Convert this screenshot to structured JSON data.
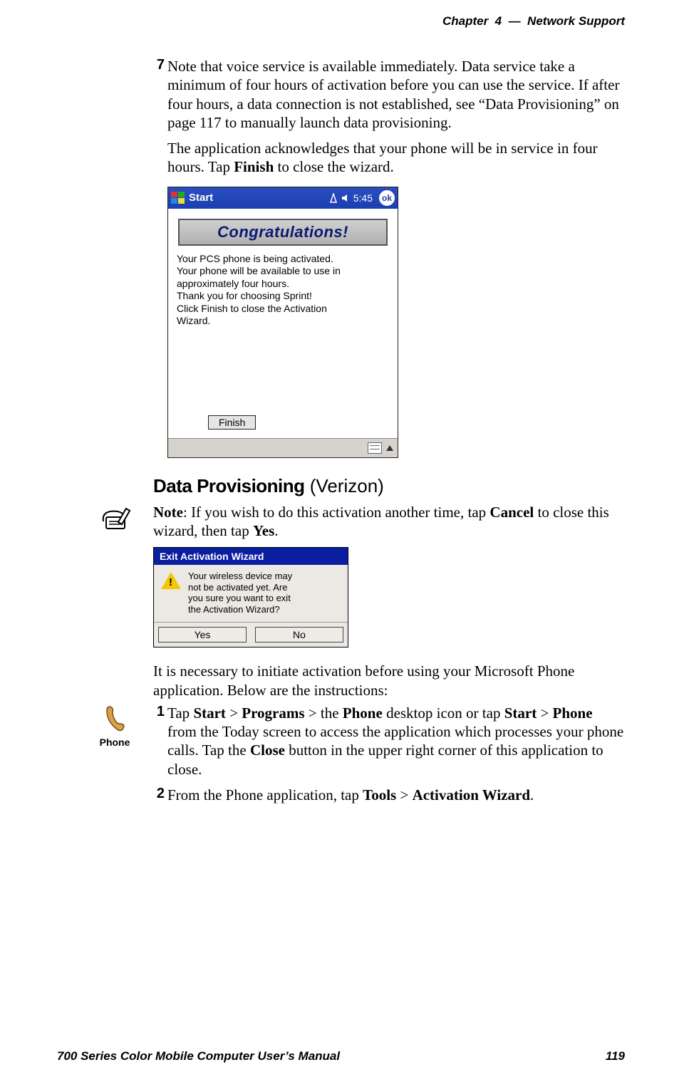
{
  "header": {
    "chapter_label": "Chapter",
    "chapter_number": "4",
    "separator": "—",
    "chapter_title": "Network Support"
  },
  "step7": {
    "number": "7",
    "para1": "Note that voice service is available immediately. Data service take a minimum of four hours of activation before you can use the service. If after four hours, a data connection is not established, see “Data Provisioning” on page 117 to manually launch data provisioning.",
    "para2_a": "The application acknowledges that your phone will be in service in four hours. Tap ",
    "para2_b": "Finish",
    "para2_c": " to close the wizard."
  },
  "ppc": {
    "start_label": "Start",
    "clock": "5:45",
    "ok": "ok",
    "banner": "Congratulations!",
    "msg": [
      "Your PCS phone is being activated.",
      "Your phone will be available to use in",
      "approximately four hours.",
      "Thank you for choosing Sprint!",
      "Click Finish to close the Activation",
      "Wizard."
    ],
    "finish_btn": "Finish"
  },
  "section": {
    "title_bold": "Data Provisioning",
    "title_light": " (Verizon)"
  },
  "note": {
    "label": "Note",
    "text_a": ": If you wish to do this activation another time, tap ",
    "bold1": "Cancel",
    "text_b": " to close this wizard, then tap ",
    "bold2": "Yes",
    "text_c": "."
  },
  "exit_dialog": {
    "title": "Exit Activation Wizard",
    "msg": [
      "Your wireless device may",
      "not be activated yet.  Are",
      "you sure you want to exit",
      "the Activation Wizard?"
    ],
    "yes": "Yes",
    "no": "No"
  },
  "intro_para": "It is necessary to initiate activation before using your Microsoft Phone application. Below are the instructions:",
  "phone_icon_label": "Phone",
  "step1": {
    "number": "1",
    "t1": "Tap ",
    "b1": "Start",
    "t2": " > ",
    "b2": "Programs",
    "t3": " > the ",
    "b3": "Phone",
    "t4": " desktop icon or tap ",
    "b4": "Start",
    "t5": " > ",
    "b5": "Phone",
    "t6": " from the Today screen to access the application which processes your phone calls. Tap the ",
    "b6": "Close",
    "t7": " button in the upper right corner of this application to close."
  },
  "step2": {
    "number": "2",
    "t1": "From the Phone application, tap ",
    "b1": "Tools",
    "t2": " > ",
    "b2": "Activation Wizard",
    "t3": "."
  },
  "footer": {
    "manual_title": "700 Series Color Mobile Computer User’s Manual",
    "page_number": "119"
  }
}
